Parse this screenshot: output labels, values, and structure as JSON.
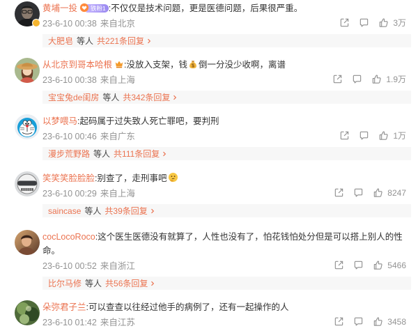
{
  "colors": {
    "accent": "#eb7350",
    "text": "#333333",
    "meta": "#939393",
    "reply_bg": "#f7f7f7",
    "icon": "#8f8f8f"
  },
  "comments": [
    {
      "user": "黄埔一投",
      "badge_icon": "fan-heart-icon",
      "badge_label": "铁粉1",
      "text": ":不仅仅是技术问题，更是医德问题，后果很严重。",
      "date": "23-6-10 00:38",
      "location": "来自北京",
      "likes": "3万",
      "reply_user": "大肥皂",
      "reply_suffix": "等人",
      "reply_count": "共221条回复"
    },
    {
      "user": "从北京到哥本哈根",
      "badge_icon": "crown-icon",
      "text_before": ":没放入支架，钱",
      "emoji": "money-bag-emoji-icon",
      "text_after": "倒一分没少收啊，离谱",
      "date": "23-6-10 00:38",
      "location": "来自上海",
      "likes": "1.9万",
      "reply_user": "宝宝兔de闺房",
      "reply_suffix": "等人",
      "reply_count": "共342条回复"
    },
    {
      "user": "以梦喂马",
      "text": ":起码属于过失致人死亡罪吧，要判刑",
      "date": "23-6-10 00:46",
      "location": "来自广东",
      "likes": "1万",
      "reply_user": "漫步荒野路",
      "reply_suffix": "等人",
      "reply_count": "共111条回复"
    },
    {
      "user": "笑笑笑脸脸脸",
      "text": ":别查了，走刑事吧",
      "emoji": "thinking-face-emoji-icon",
      "date": "23-6-10 00:29",
      "location": "来自上海",
      "likes": "8247",
      "reply_user": "saincase",
      "reply_suffix": "等人",
      "reply_count": "共39条回复"
    },
    {
      "user": "cocLocoRoco",
      "text": ":这个医生医德没有就算了，人性也没有了，怕花钱怕处分但是可以搭上别人的性命。",
      "date": "23-6-10 00:52",
      "location": "来自浙江",
      "likes": "5466",
      "reply_user": "比尔马修",
      "reply_suffix": "等人",
      "reply_count": "共56条回复"
    },
    {
      "user": "朵弥君子兰",
      "text": ":可以查查以往经过他手的病例了，还有一起操作的人",
      "date": "23-6-10 01:42",
      "location": "来自江苏",
      "likes": "3458"
    }
  ]
}
